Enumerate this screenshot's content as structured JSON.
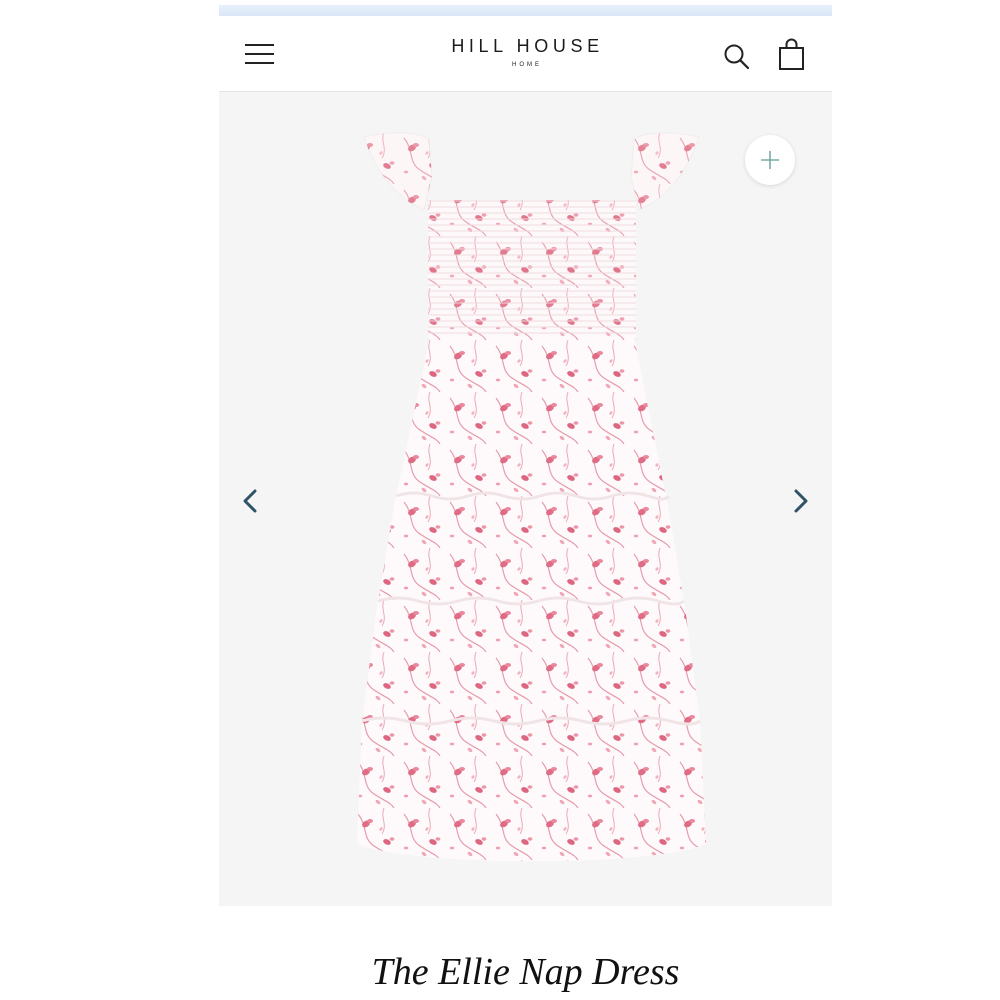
{
  "header": {
    "brand_name": "HILL HOUSE",
    "brand_sub": "HOME",
    "icons": {
      "menu": "hamburger-menu-icon",
      "search": "search-icon",
      "cart": "shopping-bag-icon"
    }
  },
  "gallery": {
    "image_alt": "dress-photo",
    "icons": {
      "zoom": "plus-icon",
      "prev": "chevron-left-icon",
      "next": "chevron-right-icon"
    },
    "colors": {
      "arrow": "#2f5468",
      "zoom_plus": "#7aa8a4",
      "background": "#f5f5f5",
      "print_pink": "#e07a8f"
    }
  },
  "product": {
    "title": "The Ellie Nap Dress"
  }
}
